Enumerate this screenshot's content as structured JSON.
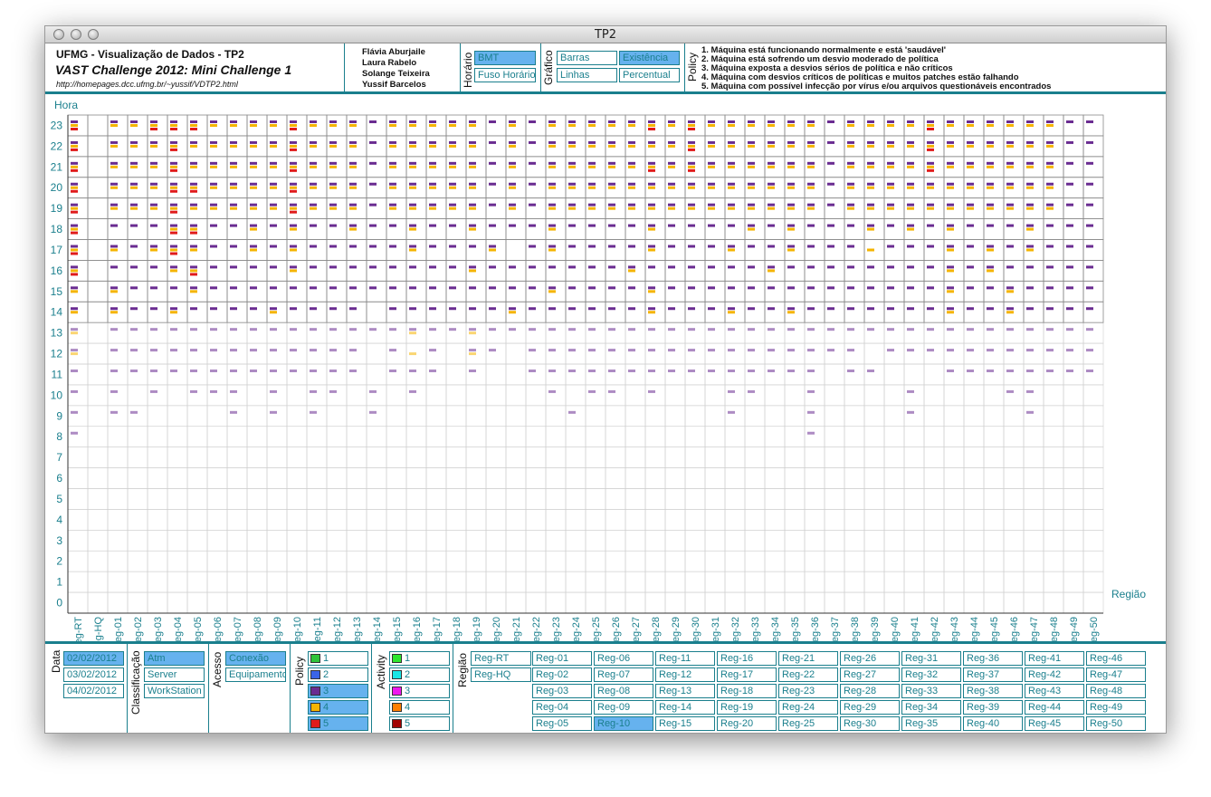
{
  "window": {
    "title": "TP2"
  },
  "header": {
    "title": "UFMG - Visualização de Dados - TP2",
    "subtitle": "VAST Challenge 2012: Mini Challenge 1",
    "url": "http://homepages.dcc.ufmg.br/~yussif/VDTP2.html",
    "authors": [
      "Flávia Aburjaile",
      "Laura Rabelo",
      "Solange Teixeira",
      "Yussif Barcelos"
    ],
    "horario": {
      "label": "Horário",
      "options": [
        {
          "label": "BMT",
          "selected": true
        },
        {
          "label": "Fuso Horário",
          "selected": false
        }
      ]
    },
    "grafico": {
      "label": "Gráfico",
      "options": [
        {
          "label": "Barras",
          "selected": false
        },
        {
          "label": "Existência",
          "selected": true
        },
        {
          "label": "Linhas",
          "selected": false
        },
        {
          "label": "Percentual",
          "selected": false
        }
      ]
    },
    "policy": {
      "label": "Policy",
      "items": [
        "1. Máquina está funcionando normalmente e está 'saudável'",
        "2. Máquina está sofrendo um desvio moderado de política",
        "3. Máquina exposta a desvios sérios de política e não críticos",
        "4. Máquina com desvios críticos de políticas e muitos patches estão falhando",
        "5. Máquina com possível infecção por vírus e/ou arquivos questionáveis encontrados"
      ]
    }
  },
  "chart_data": {
    "type": "heatmap",
    "ylabel": "Hora",
    "xlabel": "Região",
    "yticks": [
      0,
      1,
      2,
      3,
      4,
      5,
      6,
      7,
      8,
      9,
      10,
      11,
      12,
      13,
      14,
      15,
      16,
      17,
      18,
      19,
      20,
      21,
      22,
      23
    ],
    "categories": [
      "Reg-RT",
      "Reg-HQ",
      "Reg-01",
      "Reg-02",
      "Reg-03",
      "Reg-04",
      "Reg-05",
      "Reg-06",
      "Reg-07",
      "Reg-08",
      "Reg-09",
      "Reg-10",
      "Reg-11",
      "Reg-12",
      "Reg-13",
      "Reg-14",
      "Reg-15",
      "Reg-16",
      "Reg-17",
      "Reg-18",
      "Reg-19",
      "Reg-20",
      "Reg-21",
      "Reg-22",
      "Reg-23",
      "Reg-24",
      "Reg-25",
      "Reg-26",
      "Reg-27",
      "Reg-28",
      "Reg-29",
      "Reg-30",
      "Reg-31",
      "Reg-32",
      "Reg-33",
      "Reg-34",
      "Reg-35",
      "Reg-36",
      "Reg-37",
      "Reg-38",
      "Reg-39",
      "Reg-40",
      "Reg-41",
      "Reg-42",
      "Reg-43",
      "Reg-44",
      "Reg-45",
      "Reg-46",
      "Reg-47",
      "Reg-48",
      "Reg-49",
      "Reg-50"
    ],
    "legend_colors": {
      "3": "#6a2c91",
      "4": "#f5b400",
      "5": "#e01b1b"
    },
    "highlighted_hours": [
      14,
      23
    ],
    "policy3_absent": [
      [
        8,
        "all_except",
        [
          0,
          37
        ]
      ],
      [
        9,
        "all_except",
        [
          0,
          2,
          3,
          8,
          10,
          12,
          15,
          25,
          33,
          37,
          42,
          48
        ]
      ],
      [
        10,
        "all_except",
        [
          0,
          2,
          4,
          6,
          7,
          8,
          10,
          12,
          13,
          15,
          17,
          24,
          26,
          27,
          29,
          33,
          34,
          37,
          42,
          47,
          48
        ]
      ],
      [
        11,
        "none_except_missing",
        [
          1,
          15,
          19,
          21,
          22,
          38,
          41,
          42,
          43
        ]
      ],
      [
        12,
        "none_except_missing",
        [
          1,
          15,
          17,
          19,
          22,
          40
        ]
      ],
      [
        13,
        "none_except_missing",
        [
          1
        ]
      ],
      [
        14,
        "missing",
        [
          1,
          15
        ]
      ],
      [
        15,
        "missing",
        [
          1
        ]
      ],
      [
        16,
        "missing",
        [
          1
        ]
      ],
      [
        17,
        "missing",
        [
          1,
          22,
          40
        ]
      ],
      [
        18,
        "missing",
        [
          1
        ]
      ],
      [
        19,
        "missing",
        [
          1
        ]
      ],
      [
        20,
        "missing",
        [
          1
        ]
      ],
      [
        21,
        "missing",
        [
          1
        ]
      ],
      [
        22,
        "missing",
        [
          1
        ]
      ],
      [
        23,
        "missing",
        [
          1
        ]
      ]
    ],
    "policy4": {
      "23": [
        0,
        2,
        3,
        4,
        5,
        6,
        7,
        8,
        9,
        10,
        11,
        12,
        13,
        14,
        16,
        17,
        18,
        19,
        20,
        22,
        24,
        25,
        26,
        27,
        28,
        29,
        30,
        31,
        32,
        33,
        34,
        35,
        36,
        37,
        39,
        40,
        41,
        42,
        43,
        44,
        45,
        46,
        47,
        48,
        49
      ],
      "22": [
        0,
        2,
        3,
        4,
        5,
        6,
        7,
        8,
        9,
        10,
        11,
        12,
        13,
        14,
        16,
        17,
        18,
        19,
        20,
        22,
        24,
        25,
        26,
        27,
        28,
        29,
        30,
        31,
        32,
        33,
        34,
        35,
        36,
        37,
        39,
        40,
        41,
        42,
        43,
        44,
        45,
        46,
        47,
        48,
        49
      ],
      "21": [
        0,
        2,
        3,
        4,
        5,
        6,
        7,
        8,
        9,
        10,
        11,
        12,
        13,
        14,
        16,
        17,
        18,
        19,
        20,
        22,
        24,
        25,
        26,
        27,
        28,
        29,
        30,
        31,
        32,
        33,
        34,
        35,
        36,
        37,
        39,
        40,
        41,
        42,
        43,
        44,
        45,
        46,
        47,
        48,
        49
      ],
      "20": [
        0,
        2,
        3,
        4,
        5,
        6,
        7,
        8,
        9,
        10,
        11,
        12,
        13,
        14,
        16,
        17,
        18,
        19,
        20,
        22,
        24,
        25,
        26,
        27,
        28,
        29,
        30,
        31,
        32,
        33,
        34,
        35,
        36,
        37,
        39,
        40,
        41,
        42,
        43,
        44,
        45,
        46,
        47,
        48,
        49
      ],
      "19": [
        0,
        2,
        3,
        4,
        5,
        6,
        7,
        8,
        9,
        10,
        11,
        12,
        13,
        14,
        16,
        17,
        18,
        19,
        20,
        22,
        24,
        25,
        26,
        27,
        28,
        29,
        30,
        31,
        32,
        33,
        34,
        35,
        36,
        37,
        39,
        40,
        41,
        42,
        43,
        44,
        45,
        46,
        47,
        48,
        49
      ],
      "18": [
        0,
        5,
        6,
        9,
        11,
        14,
        17,
        20,
        24,
        29,
        34,
        36,
        40,
        42,
        44,
        48
      ],
      "17": [
        0,
        2,
        4,
        5,
        6,
        9,
        11,
        17,
        21,
        24,
        29,
        33,
        36,
        40,
        44,
        46,
        48
      ],
      "16": [
        0,
        5,
        6,
        11,
        20,
        28,
        35,
        44,
        46
      ],
      "15": [
        0,
        2,
        6,
        24,
        29,
        44,
        47
      ],
      "14": [
        0,
        2,
        5,
        10,
        22,
        29,
        33,
        36,
        44,
        47
      ],
      "13": [
        0,
        17,
        20
      ],
      "12": [
        0,
        17,
        20
      ]
    },
    "policy5": {
      "23": [
        0,
        4,
        5,
        6,
        11,
        29,
        31,
        43
      ],
      "22": [
        0,
        5,
        11,
        31,
        43
      ],
      "21": [
        0,
        5,
        11,
        29,
        31,
        43
      ],
      "20": [
        0,
        5,
        6,
        11
      ],
      "19": [
        0,
        5,
        11
      ],
      "18": [
        0,
        5,
        6
      ],
      "17": [
        0,
        5
      ],
      "16": [
        0,
        6
      ]
    }
  },
  "footer": {
    "data": {
      "label": "Data",
      "options": [
        {
          "label": "02/02/2012",
          "selected": true
        },
        {
          "label": "03/02/2012",
          "selected": false
        },
        {
          "label": "04/02/2012",
          "selected": false
        }
      ]
    },
    "classificacao": {
      "label": "Classificação",
      "options": [
        {
          "label": "Atm",
          "selected": true
        },
        {
          "label": "Server",
          "selected": false
        },
        {
          "label": "WorkStation",
          "selected": false
        }
      ]
    },
    "acesso": {
      "label": "Acesso",
      "options": [
        {
          "label": "Conexão",
          "selected": true
        },
        {
          "label": "Equipamento",
          "selected": false
        }
      ]
    },
    "policy": {
      "label": "Policy",
      "options": [
        {
          "label": "1",
          "selected": false,
          "color": "#2ec43b"
        },
        {
          "label": "2",
          "selected": false,
          "color": "#3a64e8"
        },
        {
          "label": "3",
          "selected": true,
          "color": "#6a2c91"
        },
        {
          "label": "4",
          "selected": true,
          "color": "#f5b400"
        },
        {
          "label": "5",
          "selected": true,
          "color": "#e01b1b"
        }
      ]
    },
    "activity": {
      "label": "Activity",
      "options": [
        {
          "label": "1",
          "selected": false,
          "color": "#2ee62e"
        },
        {
          "label": "2",
          "selected": false,
          "color": "#19e6e6"
        },
        {
          "label": "3",
          "selected": false,
          "color": "#ee17ee"
        },
        {
          "label": "4",
          "selected": false,
          "color": "#ff7f00"
        },
        {
          "label": "5",
          "selected": false,
          "color": "#a30000"
        }
      ]
    },
    "regiao": {
      "label": "Região",
      "special": [
        "Reg-RT",
        "Reg-HQ"
      ],
      "regions": [
        "Reg-01",
        "Reg-02",
        "Reg-03",
        "Reg-04",
        "Reg-05",
        "Reg-06",
        "Reg-07",
        "Reg-08",
        "Reg-09",
        "Reg-10",
        "Reg-11",
        "Reg-12",
        "Reg-13",
        "Reg-14",
        "Reg-15",
        "Reg-16",
        "Reg-17",
        "Reg-18",
        "Reg-19",
        "Reg-20",
        "Reg-21",
        "Reg-22",
        "Reg-23",
        "Reg-24",
        "Reg-25",
        "Reg-26",
        "Reg-27",
        "Reg-28",
        "Reg-29",
        "Reg-30",
        "Reg-31",
        "Reg-32",
        "Reg-33",
        "Reg-34",
        "Reg-35",
        "Reg-36",
        "Reg-37",
        "Reg-38",
        "Reg-39",
        "Reg-40",
        "Reg-41",
        "Reg-42",
        "Reg-43",
        "Reg-44",
        "Reg-45",
        "Reg-46",
        "Reg-47",
        "Reg-48",
        "Reg-49",
        "Reg-50"
      ],
      "selected": "Reg-10"
    }
  }
}
